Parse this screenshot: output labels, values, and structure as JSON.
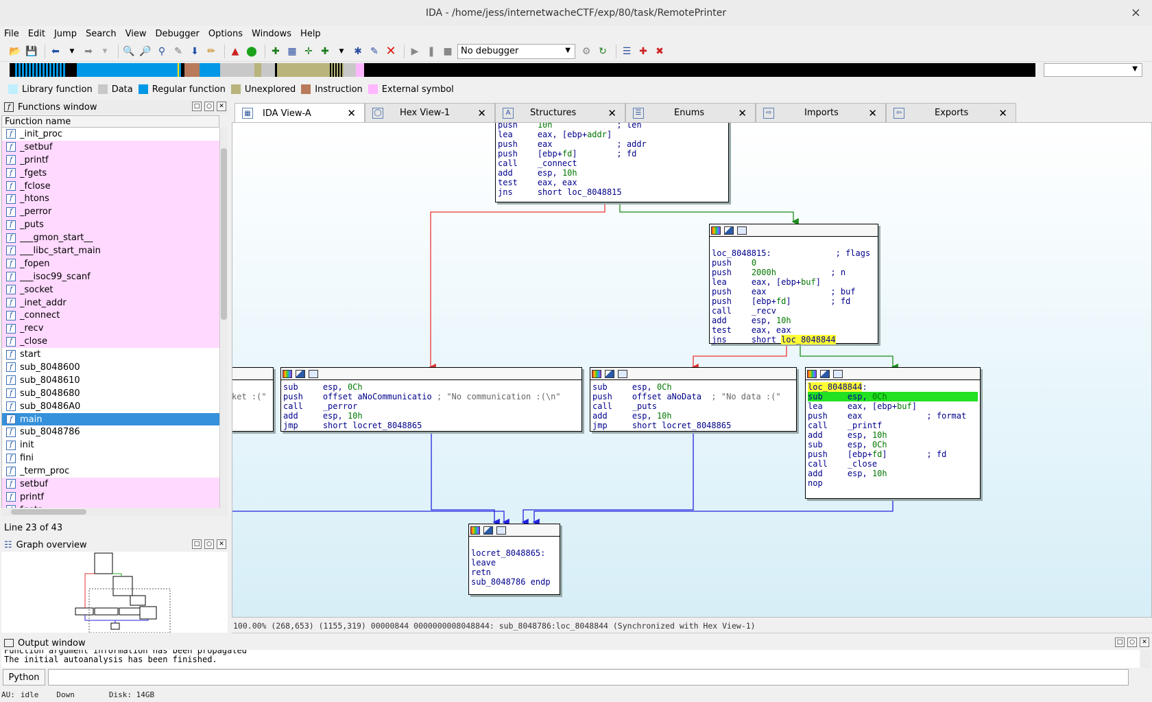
{
  "window": {
    "title": "IDA - /home/jess/internetwacheCTF/exp/80/task/RemotePrinter",
    "close": "×"
  },
  "menu": [
    "File",
    "Edit",
    "Jump",
    "Search",
    "View",
    "Debugger",
    "Options",
    "Windows",
    "Help"
  ],
  "toolbar": {
    "debugger_select": "No debugger"
  },
  "legend": [
    {
      "label": "Library function",
      "color": "#bfefff"
    },
    {
      "label": "Data",
      "color": "#c8c8c8"
    },
    {
      "label": "Regular function",
      "color": "#0098e6"
    },
    {
      "label": "Unexplored",
      "color": "#b8b47c"
    },
    {
      "label": "Instruction",
      "color": "#b87a5a"
    },
    {
      "label": "External symbol",
      "color": "#ffb6ff"
    }
  ],
  "functions_window": {
    "title": "Functions window",
    "column": "Function name",
    "line_status": "Line 23 of 43",
    "rows": [
      {
        "name": "_init_proc",
        "kind": "reg"
      },
      {
        "name": "_setbuf",
        "kind": "lib"
      },
      {
        "name": "_printf",
        "kind": "lib"
      },
      {
        "name": "_fgets",
        "kind": "lib"
      },
      {
        "name": "_fclose",
        "kind": "lib"
      },
      {
        "name": "_htons",
        "kind": "lib"
      },
      {
        "name": "_perror",
        "kind": "lib"
      },
      {
        "name": "_puts",
        "kind": "lib"
      },
      {
        "name": "___gmon_start__",
        "kind": "lib"
      },
      {
        "name": "___libc_start_main",
        "kind": "lib"
      },
      {
        "name": "_fopen",
        "kind": "lib"
      },
      {
        "name": "___isoc99_scanf",
        "kind": "lib"
      },
      {
        "name": "_socket",
        "kind": "lib"
      },
      {
        "name": "_inet_addr",
        "kind": "lib"
      },
      {
        "name": "_connect",
        "kind": "lib"
      },
      {
        "name": "_recv",
        "kind": "lib"
      },
      {
        "name": "_close",
        "kind": "lib"
      },
      {
        "name": "start",
        "kind": "reg"
      },
      {
        "name": "sub_8048600",
        "kind": "reg"
      },
      {
        "name": "sub_8048610",
        "kind": "reg"
      },
      {
        "name": "sub_8048680",
        "kind": "reg"
      },
      {
        "name": "sub_80486A0",
        "kind": "reg"
      },
      {
        "name": "main",
        "kind": "sel"
      },
      {
        "name": "sub_8048786",
        "kind": "reg"
      },
      {
        "name": "init",
        "kind": "reg"
      },
      {
        "name": "fini",
        "kind": "reg"
      },
      {
        "name": "_term_proc",
        "kind": "reg"
      },
      {
        "name": "setbuf",
        "kind": "lib"
      },
      {
        "name": "printf",
        "kind": "lib"
      },
      {
        "name": "fgets",
        "kind": "lib"
      }
    ]
  },
  "graph_overview": {
    "title": "Graph overview"
  },
  "tabs": [
    {
      "label": "IDA View-A",
      "icon": "ida-view-icon",
      "active": true
    },
    {
      "label": "Hex View-1",
      "icon": "hex-view-icon",
      "active": false
    },
    {
      "label": "Structures",
      "icon": "structures-icon",
      "active": false
    },
    {
      "label": "Enums",
      "icon": "enums-icon",
      "active": false
    },
    {
      "label": "Imports",
      "icon": "imports-icon",
      "active": false
    },
    {
      "label": "Exports",
      "icon": "exports-icon",
      "active": false
    }
  ],
  "graph_status": "100.00% (268,653) (1155,319) 00000844 0000000008048844: sub_8048786:loc_8048844 (Synchronized with Hex View-1)",
  "output": {
    "title": "Output window",
    "lines": [
      "Function argument information has been propagated",
      "The initial autoanalysis has been finished."
    ],
    "python_button": "Python"
  },
  "status": {
    "au": "AU:",
    "au_state": "idle",
    "scroll": "Down",
    "disk": "Disk: 14GB"
  }
}
